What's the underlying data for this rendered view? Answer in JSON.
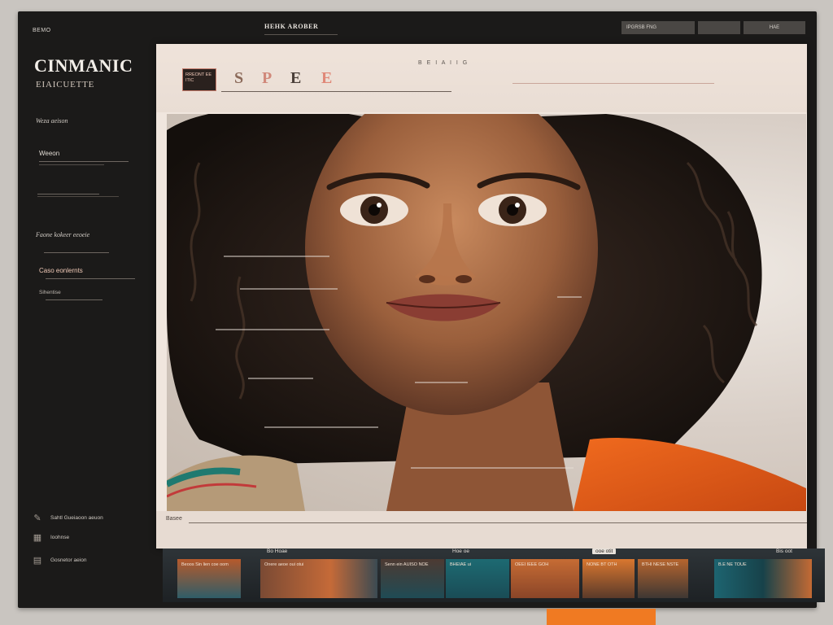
{
  "topbar": {
    "menu": "BEMO",
    "title": "HEHK AROBER",
    "buttons": [
      "IPGRSB FNG",
      "",
      "HAE"
    ]
  },
  "sidebar": {
    "brand": "CINMANIC",
    "brand_sub": "EIAICUETTE",
    "section1": "Weza aeison",
    "item1": "Weeon",
    "item2": "",
    "section2": "Faone kokeer eeoeie",
    "item3": "Caso eonlernts",
    "item4": "Sihentise",
    "bottom": [
      "Sahtl Gueiaoon aeuon",
      "Ioohnse",
      "Gosnetor aeion"
    ]
  },
  "toolbar": {
    "tag": "RREONT EE ITIC",
    "glyphs": [
      "S",
      "P",
      "E",
      "E"
    ],
    "mini": "B E I A I I G"
  },
  "photo": {
    "subject": "portrait"
  },
  "panel_foot": {
    "label": "Basee"
  },
  "filmstrip": {
    "labels": [
      "Bo Hoae",
      "Hoe oe",
      "ooe otit",
      "Bis oot"
    ],
    "thumbs": [
      "Beoos Sin lien coe oom",
      "Onere aeoe oui otui",
      "Senn ein AUISO NOE",
      "BHEIAE ui",
      "OEEI IEEE GOH",
      "NONE BT OTH",
      "BTHI NESE NSTE",
      "B.E NE TOUE"
    ]
  },
  "colors": {
    "frame": "#1b1a19",
    "panel": "#f0e6de",
    "accent": "#f07a22"
  }
}
